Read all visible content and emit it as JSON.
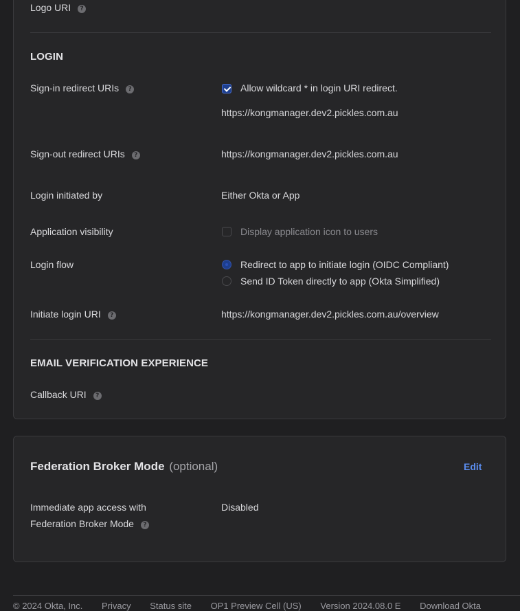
{
  "general": {
    "logo_uri_label": "Logo URI"
  },
  "login": {
    "section_title": "LOGIN",
    "sign_in_label": "Sign-in redirect URIs",
    "wildcard_label": "Allow wildcard * in login URI redirect.",
    "wildcard_checked": true,
    "sign_in_value": "https://kongmanager.dev2.pickles.com.au",
    "sign_out_label": "Sign-out redirect URIs",
    "sign_out_value": "https://kongmanager.dev2.pickles.com.au",
    "initiated_by_label": "Login initiated by",
    "initiated_by_value": "Either Okta or App",
    "visibility_label": "Application visibility",
    "visibility_option": "Display application icon to users",
    "visibility_checked": false,
    "flow_label": "Login flow",
    "flow_options": [
      "Redirect to app to initiate login (OIDC Compliant)",
      "Send ID Token directly to app (Okta Simplified)"
    ],
    "flow_selected": 0,
    "initiate_uri_label": "Initiate login URI",
    "initiate_uri_value": "https://kongmanager.dev2.pickles.com.au/overview"
  },
  "email_verification": {
    "section_title": "EMAIL VERIFICATION EXPERIENCE",
    "callback_label": "Callback URI"
  },
  "federation": {
    "title": "Federation Broker Mode",
    "optional": "(optional)",
    "edit_label": "Edit",
    "access_label_line1": "Immediate app access with",
    "access_label_line2": "Federation Broker Mode",
    "access_value": "Disabled"
  },
  "footer": {
    "items": [
      "© 2024 Okta, Inc.",
      "Privacy",
      "Status site",
      "OP1 Preview Cell (US)",
      "Version 2024.08.0 E",
      "Download Okta"
    ]
  },
  "colors": {
    "background": "#1f1f21",
    "card": "#262628",
    "accent": "#5b8def",
    "checkbox_fill": "#1d3f8f"
  }
}
